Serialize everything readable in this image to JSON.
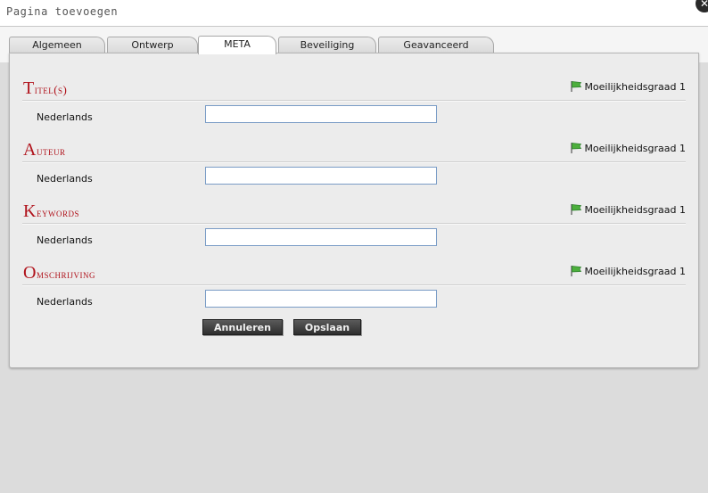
{
  "dialog": {
    "title": "Pagina toevoegen",
    "close_symbol": "✕"
  },
  "tabs": [
    {
      "label": "Algemeen"
    },
    {
      "label": "Ontwerp"
    },
    {
      "label": "META",
      "active": true
    },
    {
      "label": "Beveiliging"
    },
    {
      "label": "Geavanceerd"
    }
  ],
  "sections": [
    {
      "title": "Titel(s)",
      "difficulty": "Moeilijkheidsgraad 1",
      "language": "Nederlands",
      "value": ""
    },
    {
      "title": "Auteur",
      "difficulty": "Moeilijkheidsgraad 1",
      "language": "Nederlands",
      "value": ""
    },
    {
      "title": "Keywords",
      "difficulty": "Moeilijkheidsgraad 1",
      "language": "Nederlands",
      "value": ""
    },
    {
      "title": "Omschrijving",
      "difficulty": "Moeilijkheidsgraad 1",
      "language": "Nederlands",
      "value": ""
    }
  ],
  "buttons": {
    "cancel": "Annuleren",
    "save": "Opslaan"
  },
  "colors": {
    "section_title": "#b0121b",
    "input_border": "#7a9cc6",
    "button_bg": "#3a3a3a",
    "flag": "#4caf3c"
  }
}
